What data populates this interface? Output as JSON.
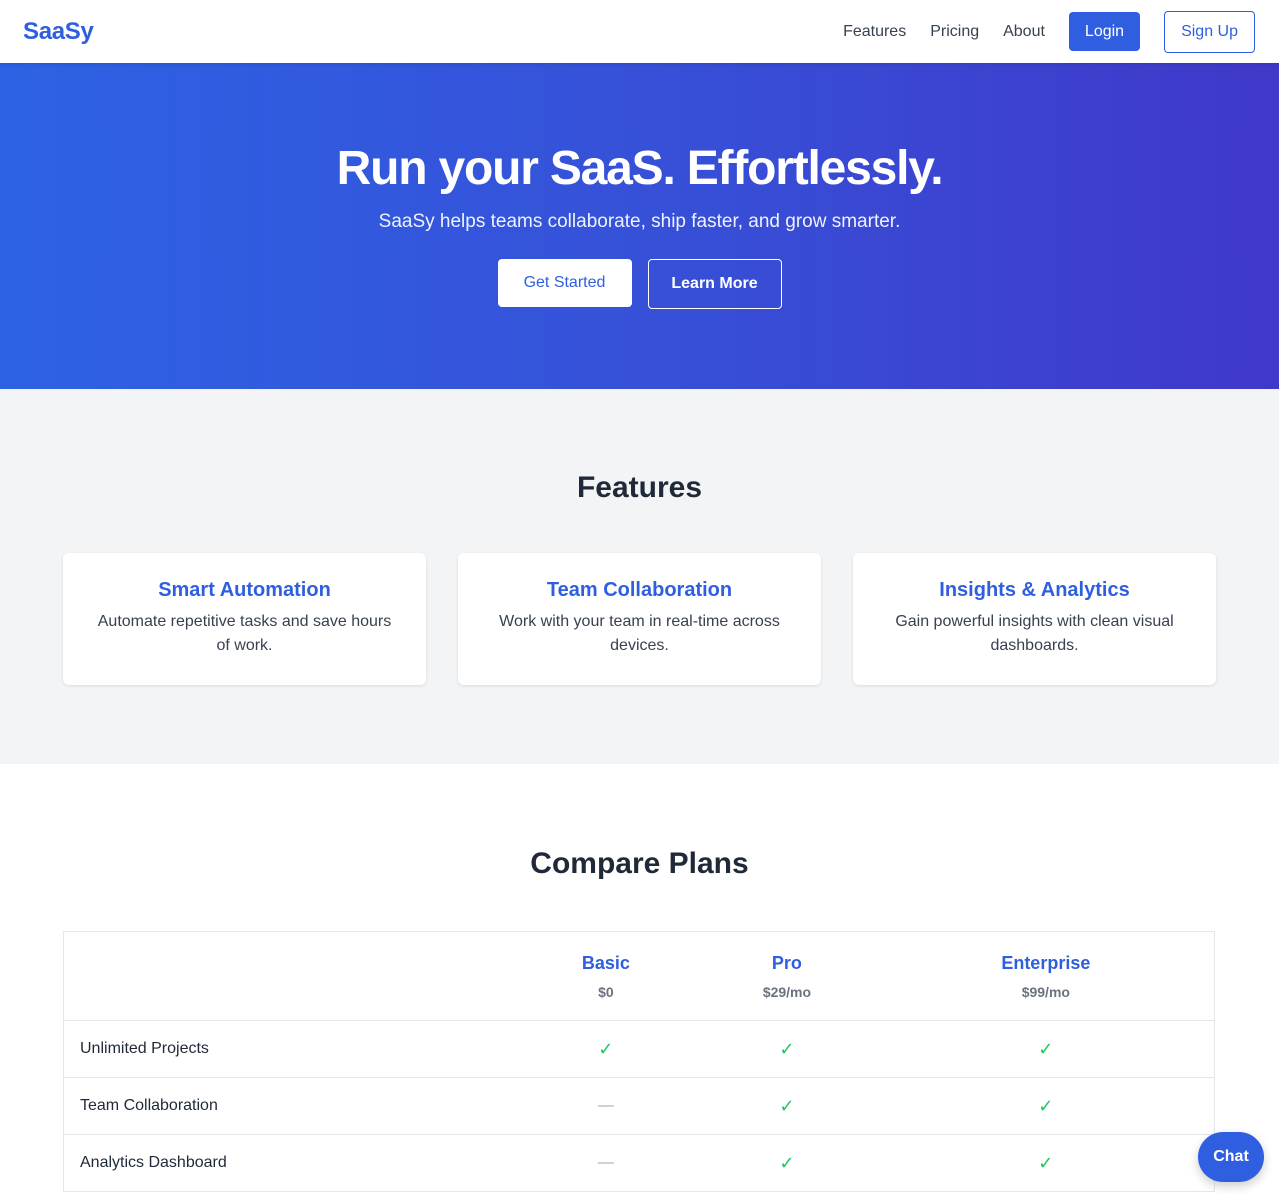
{
  "navbar": {
    "logo": "SaaSy",
    "links": [
      "Features",
      "Pricing",
      "About"
    ],
    "login_label": "Login",
    "signup_label": "Sign Up"
  },
  "hero": {
    "title": "Run your SaaS. Effortlessly.",
    "subtitle": "SaaSy helps teams collaborate, ship faster, and grow smarter.",
    "primary_label": "Get Started",
    "secondary_label": "Learn More"
  },
  "features": {
    "title": "Features",
    "cards": [
      {
        "title": "Smart Automation",
        "desc": "Automate repetitive tasks and save hours of work."
      },
      {
        "title": "Team Collaboration",
        "desc": "Work with your team in real-time across devices."
      },
      {
        "title": "Insights & Analytics",
        "desc": "Gain powerful insights with clean visual dashboards."
      }
    ]
  },
  "plans": {
    "title": "Compare Plans",
    "columns": [
      {
        "name": "Basic",
        "price": "$0"
      },
      {
        "name": "Pro",
        "price": "$29/mo"
      },
      {
        "name": "Enterprise",
        "price": "$99/mo"
      }
    ],
    "check_symbol": "✓",
    "dash_symbol": "—",
    "rows": [
      {
        "feature": "Unlimited Projects",
        "values": [
          "✓",
          "✓",
          "✓"
        ]
      },
      {
        "feature": "Team Collaboration",
        "values": [
          "—",
          "✓",
          "✓"
        ]
      },
      {
        "feature": "Analytics Dashboard",
        "values": [
          "—",
          "✓",
          "✓"
        ]
      }
    ]
  },
  "chat": {
    "label": "Chat"
  },
  "colors": {
    "brand": "#2f5fe0",
    "check": "#22c55e",
    "hero_start": "#2d62e5",
    "hero_end": "#4038c9"
  }
}
